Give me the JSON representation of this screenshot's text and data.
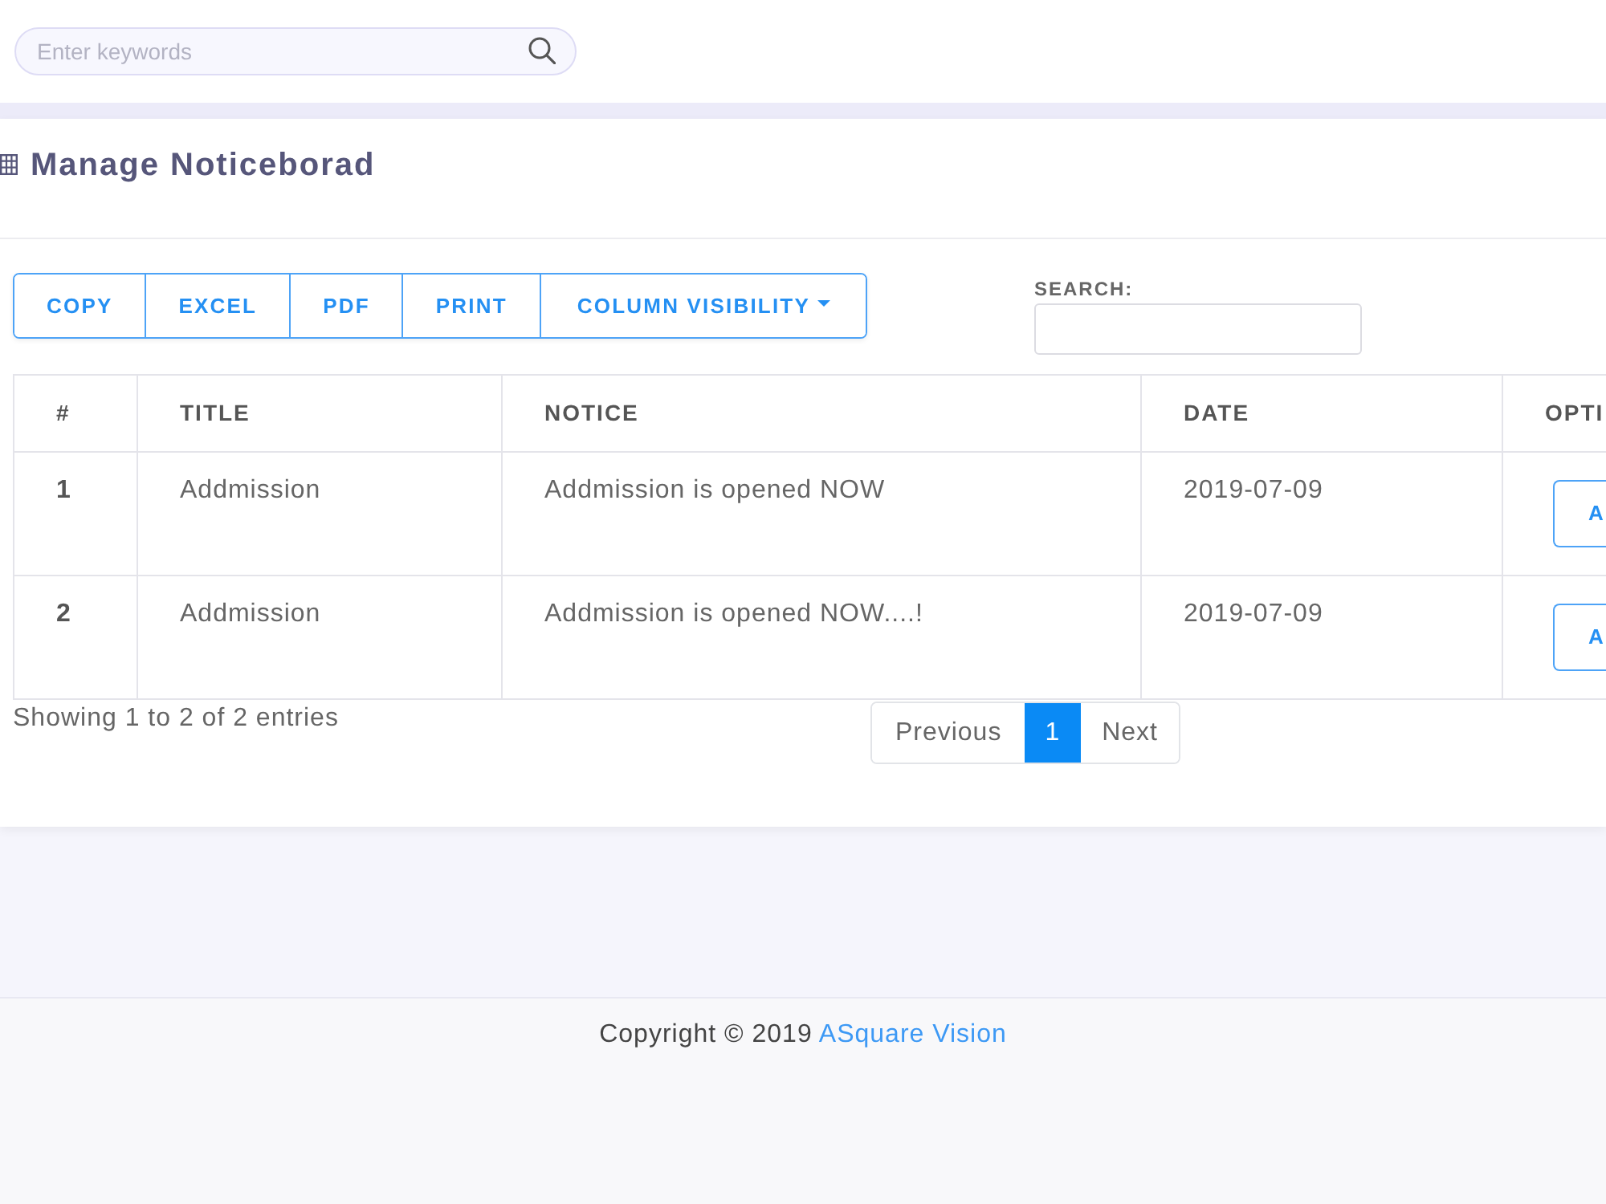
{
  "header": {
    "search": {
      "placeholder": "Enter keywords"
    }
  },
  "page": {
    "title": "Manage Noticeborad"
  },
  "export_buttons": [
    {
      "label": "COPY",
      "kind": "button"
    },
    {
      "label": "EXCEL",
      "kind": "button"
    },
    {
      "label": "PDF",
      "kind": "button"
    },
    {
      "label": "PRINT",
      "kind": "button"
    },
    {
      "label": "COLUMN VISIBILITY",
      "kind": "dropdown"
    }
  ],
  "search": {
    "label": "SEARCH:"
  },
  "table": {
    "columns": [
      "#",
      "TITLE",
      "NOTICE",
      "DATE",
      "OPTI"
    ],
    "rows": [
      {
        "number": "1",
        "title": "Addmission",
        "notice": "Addmission is opened NOW",
        "date": "2019-07-09",
        "action": "A"
      },
      {
        "number": "2",
        "title": "Addmission",
        "notice": "Addmission is opened NOW....!",
        "date": "2019-07-09",
        "action": "A"
      }
    ]
  },
  "info": "Showing 1 to 2 of 2 entries",
  "pagination": [
    {
      "label": "Previous",
      "selected": false
    },
    {
      "label": "1",
      "selected": true
    },
    {
      "label": "Next",
      "selected": false
    }
  ],
  "footer": {
    "text": "Copyright © 2019",
    "link": "ASquare Vision"
  }
}
